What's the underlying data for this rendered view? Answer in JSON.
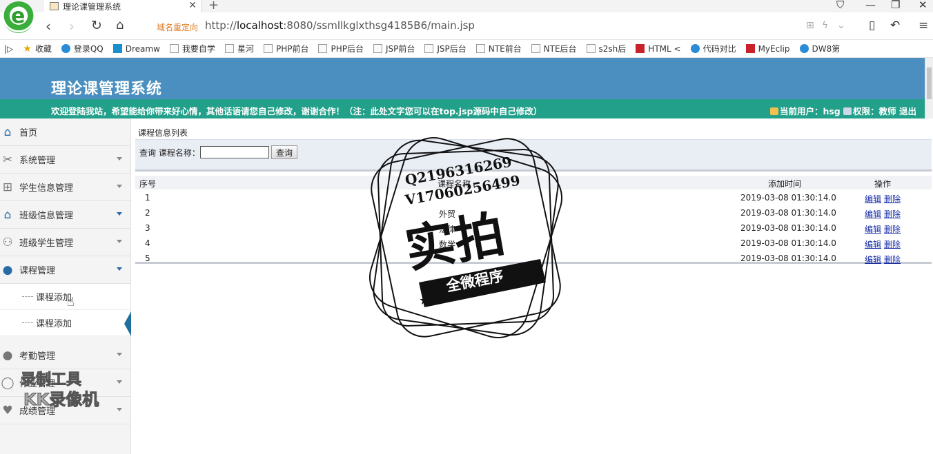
{
  "browser": {
    "tab_title": "理论课管理系统",
    "redirect_label": "域名重定向",
    "url_prefix": "http://",
    "url_host": "localhost",
    "url_rest": ":8080/ssmllkglxthsg4185B6/main.jsp",
    "bookmarks": [
      {
        "label": "收藏",
        "icon": "star-icon"
      },
      {
        "label": "登录QQ",
        "icon": "qq-icon"
      },
      {
        "label": "Dreamw",
        "icon": "dreamweaver-icon"
      },
      {
        "label": "我要自学",
        "icon": "book-icon"
      },
      {
        "label": "星河",
        "icon": "page-icon"
      },
      {
        "label": "PHP前台",
        "icon": "page-icon"
      },
      {
        "label": "PHP后台",
        "icon": "page-icon"
      },
      {
        "label": "JSP前台",
        "icon": "page-icon"
      },
      {
        "label": "JSP后台",
        "icon": "page-icon"
      },
      {
        "label": "NTE前台",
        "icon": "page-icon"
      },
      {
        "label": "NTE后台",
        "icon": "page-icon"
      },
      {
        "label": "s2sh后",
        "icon": "image-icon"
      },
      {
        "label": "HTML <",
        "icon": "html-icon"
      },
      {
        "label": "代码对比",
        "icon": "compare-icon"
      },
      {
        "label": "MyEclip",
        "icon": "myeclipse-icon"
      },
      {
        "label": "DW8第",
        "icon": "paw-icon"
      }
    ]
  },
  "header": {
    "title": "理论课管理系统",
    "welcome": "欢迎登陆我站，希望能给你带来好心情，其他话语请您自己修改，谢谢合作！（注：此处文字您可以在top.jsp源码中自己修改）",
    "current_user_label": "当前用户：hsg",
    "role_label": "权限：教师",
    "logout_label": "退出"
  },
  "sidebar": {
    "items": [
      {
        "label": "首页",
        "icon": "home-icon"
      },
      {
        "label": "系统管理",
        "icon": "tools-icon"
      },
      {
        "label": "学生信息管理",
        "icon": "grid-icon"
      },
      {
        "label": "班级信息管理",
        "icon": "house-icon"
      },
      {
        "label": "班级学生管理",
        "icon": "users-icon"
      },
      {
        "label": "课程管理",
        "icon": "user-icon"
      },
      {
        "label": "考勤管理",
        "icon": "user-icon"
      },
      {
        "label": "作业管理",
        "icon": "chat-icon"
      },
      {
        "label": "成绩管理",
        "icon": "heart-icon"
      }
    ],
    "subitems": [
      {
        "label": "课程添加"
      },
      {
        "label": "课程添加"
      }
    ]
  },
  "main": {
    "list_title": "课程信息列表",
    "search_label": "查询 课程名称：",
    "search_value": "",
    "search_button": "查询",
    "columns": [
      "序号",
      "课程名称",
      "添加时间",
      "操作"
    ],
    "rows": [
      {
        "no": "1",
        "name": "",
        "time": "2019-03-08 01:30:14.0"
      },
      {
        "no": "2",
        "name": "外贸",
        "time": "2019-03-08 01:30:14.0"
      },
      {
        "no": "3",
        "name": "法律",
        "time": "2019-03-08 01:30:14.0"
      },
      {
        "no": "4",
        "name": "数学",
        "time": "2019-03-08 01:30:14.0"
      },
      {
        "no": "5",
        "name": "",
        "time": "2019-03-08 01:30:14.0"
      }
    ],
    "edit_label": "编辑",
    "delete_label": "删除"
  },
  "overlay": {
    "contact_line1": "Q2196316269",
    "contact_line2": "V17060256499",
    "stamp_main": "实拍",
    "stamp_ribbon": "全微程序",
    "recorder_line1": "录制工具",
    "recorder_line2": "KK录像机"
  }
}
